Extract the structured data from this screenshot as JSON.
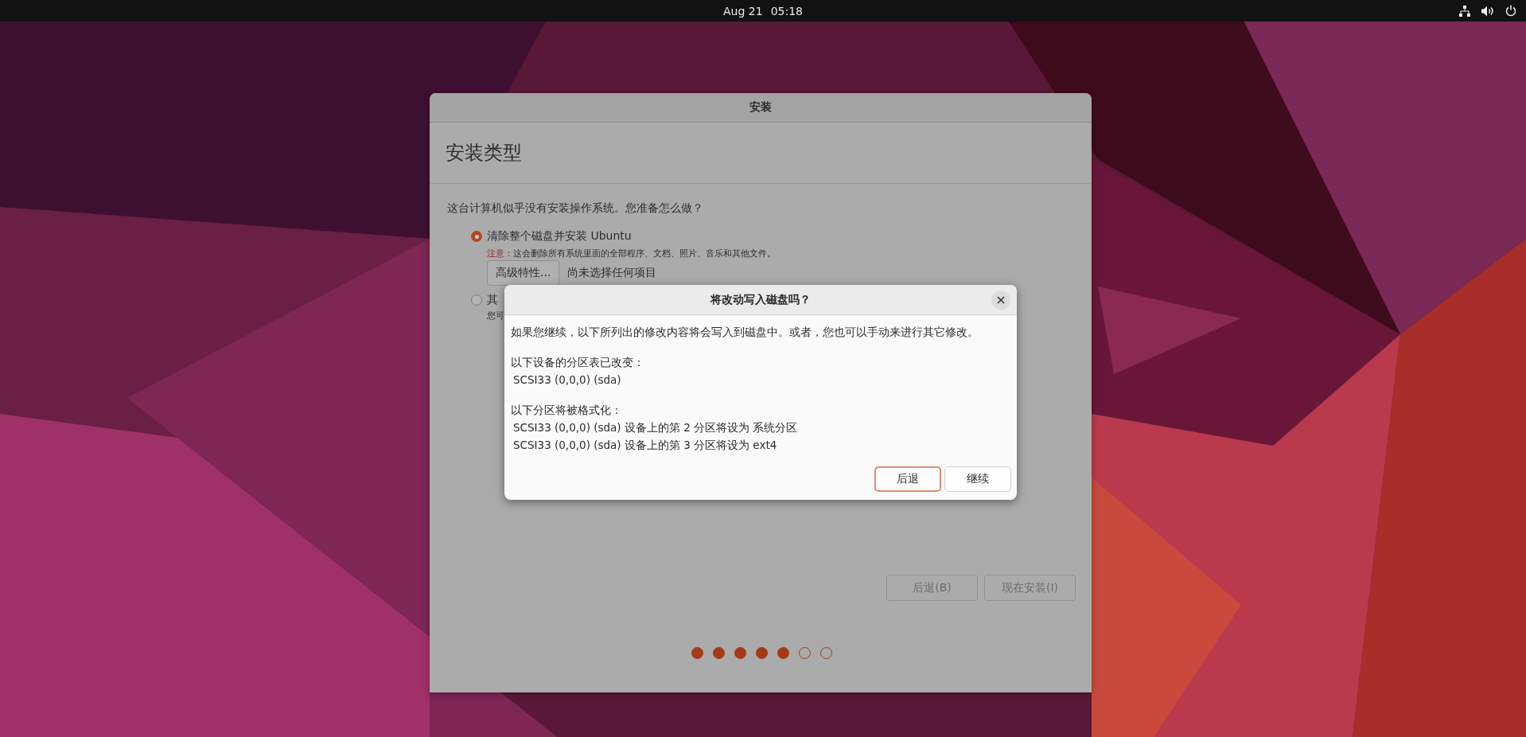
{
  "top_bar": {
    "date": "Aug 21",
    "time": "05:18"
  },
  "installer": {
    "title": "安装",
    "heading": "安装类型",
    "question": "这台计算机似乎没有安装操作系统。您准备怎么做？",
    "options": [
      {
        "label": "清除整个磁盘并安装 Ubuntu",
        "selected": true,
        "note_label": "注意：",
        "note": "这会删除所有系统里面的全部程序、文档、照片、音乐和其他文件。",
        "advanced_button": "高级特性...",
        "advanced_status": "尚未选择任何项目"
      },
      {
        "label": "其",
        "selected": false,
        "description": "您可"
      }
    ],
    "buttons": [
      {
        "label": "后退(B)"
      },
      {
        "label": "现在安装(I)"
      }
    ],
    "progress": [
      {
        "filled": true
      },
      {
        "filled": true
      },
      {
        "filled": true
      },
      {
        "filled": true
      },
      {
        "filled": true
      },
      {
        "filled": false
      },
      {
        "filled": false
      }
    ]
  },
  "dialog": {
    "title": "将改动写入磁盘吗？",
    "intro": "如果您继续，以下所列出的修改内容将会写入到磁盘中。或者，您也可以手动来进行其它修改。",
    "sections": [
      {
        "heading": "以下设备的分区表已改变：",
        "items": [
          "SCSI33 (0,0,0) (sda)"
        ]
      },
      {
        "heading": "以下分区将被格式化：",
        "items": [
          "SCSI33 (0,0,0) (sda) 设备上的第 2 分区将设为 系统分区",
          "SCSI33 (0,0,0) (sda) 设备上的第 3 分区将设为 ext4"
        ]
      }
    ],
    "buttons": [
      {
        "label": "后退",
        "focused": true
      },
      {
        "label": "继续",
        "focused": false
      }
    ]
  }
}
